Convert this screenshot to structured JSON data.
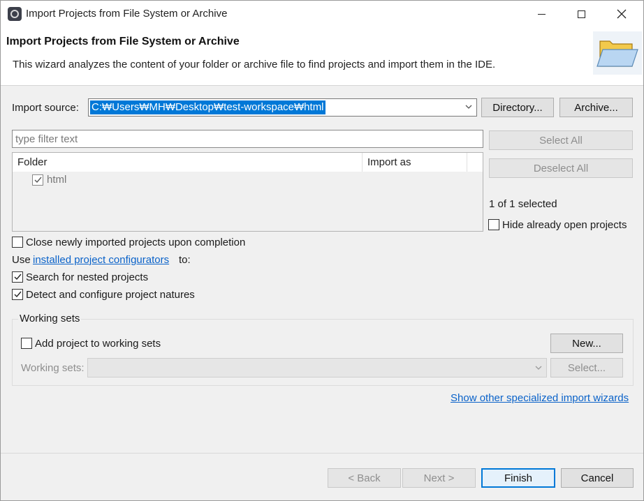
{
  "window": {
    "title": "Import Projects from File System or Archive",
    "controls": [
      "minimize",
      "maximize",
      "close"
    ]
  },
  "header": {
    "title": "Import Projects from File System or Archive",
    "description": "This wizard analyzes the content of your folder or archive file to find projects and import them in the IDE."
  },
  "import_source": {
    "label": "Import source:",
    "value": "C:\\Users\\MH\\Desktop\\test-workspace\\html",
    "display_value": "C:₩Users₩MH₩Desktop₩test-workspace₩html",
    "directory_button": "Directory...",
    "archive_button": "Archive..."
  },
  "filter": {
    "placeholder": "type filter text",
    "value": ""
  },
  "projects_table": {
    "columns": [
      "Folder",
      "Import as"
    ],
    "rows": [
      {
        "folder": "html",
        "import_as": "",
        "checked": true
      }
    ]
  },
  "side_panel": {
    "select_all": "Select All",
    "deselect_all": "Deselect All",
    "selected_count": "1 of 1 selected",
    "hide_open_label": "Hide already open projects",
    "hide_open_checked": false
  },
  "options": {
    "close_imported": {
      "label": "Close newly imported projects upon completion",
      "checked": false
    },
    "use_prefix": "Use",
    "configurators_link": "installed project configurators",
    "use_suffix": "to:",
    "search_nested": {
      "label": "Search for nested projects",
      "checked": true
    },
    "detect_natures": {
      "label": "Detect and configure project natures",
      "checked": true
    }
  },
  "working_sets": {
    "group_title": "Working sets",
    "add_label": "Add project to working sets",
    "add_checked": false,
    "new_button": "New...",
    "sets_label": "Working sets:",
    "select_button": "Select..."
  },
  "other_wizards_link": "Show other specialized import wizards",
  "footer": {
    "back": "< Back",
    "next": "Next >",
    "finish": "Finish",
    "cancel": "Cancel"
  },
  "colors": {
    "accent": "#0078d7",
    "link": "#0a62c9"
  }
}
